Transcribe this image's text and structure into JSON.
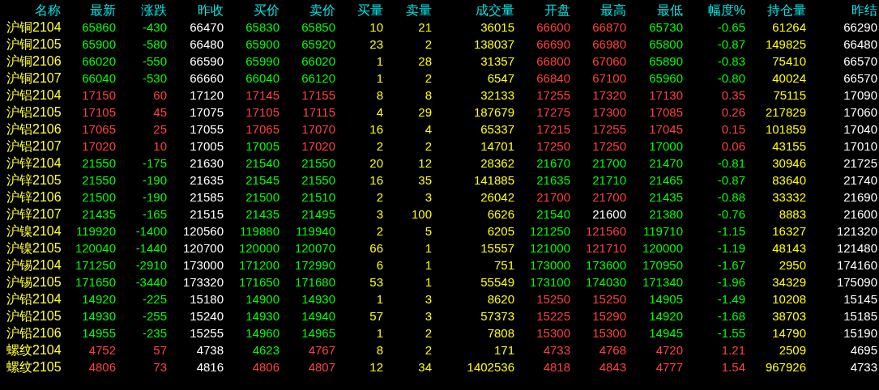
{
  "table": {
    "columns": [
      {
        "label": "名称",
        "kind": "name"
      },
      {
        "label": "最新",
        "kind": "price"
      },
      {
        "label": "涨跌",
        "kind": "change"
      },
      {
        "label": "昨收",
        "kind": "ref"
      },
      {
        "label": "买价",
        "kind": "price"
      },
      {
        "label": "卖价",
        "kind": "price"
      },
      {
        "label": "买量",
        "kind": "volume"
      },
      {
        "label": "卖量",
        "kind": "volume"
      },
      {
        "label": "成交量",
        "kind": "volume"
      },
      {
        "label": "开盘",
        "kind": "price"
      },
      {
        "label": "最高",
        "kind": "price"
      },
      {
        "label": "最低",
        "kind": "price"
      },
      {
        "label": "幅度%",
        "kind": "change"
      },
      {
        "label": "持仓量",
        "kind": "volume"
      },
      {
        "label": "昨结",
        "kind": "settle"
      }
    ],
    "rows": [
      [
        "沪铜2104",
        "65860",
        "-430",
        "66470",
        "65830",
        "65850",
        "10",
        "21",
        "36015",
        "66600",
        "66870",
        "65730",
        "-0.65",
        "61264",
        "66290"
      ],
      [
        "沪铜2105",
        "65900",
        "-580",
        "66480",
        "65900",
        "65920",
        "23",
        "2",
        "138037",
        "66690",
        "66980",
        "65800",
        "-0.87",
        "149825",
        "66480"
      ],
      [
        "沪铜2106",
        "66020",
        "-550",
        "66590",
        "65990",
        "66020",
        "1",
        "28",
        "31357",
        "66800",
        "67060",
        "65890",
        "-0.83",
        "75410",
        "66570"
      ],
      [
        "沪铜2107",
        "66040",
        "-530",
        "66660",
        "66040",
        "66120",
        "1",
        "2",
        "6547",
        "66840",
        "67100",
        "65960",
        "-0.80",
        "40024",
        "66570"
      ],
      [
        "沪铝2104",
        "17150",
        "60",
        "17120",
        "17145",
        "17155",
        "8",
        "8",
        "32133",
        "17255",
        "17320",
        "17130",
        "0.35",
        "75115",
        "17090"
      ],
      [
        "沪铝2105",
        "17105",
        "45",
        "17075",
        "17105",
        "17115",
        "4",
        "29",
        "187679",
        "17275",
        "17300",
        "17085",
        "0.26",
        "217829",
        "17060"
      ],
      [
        "沪铝2106",
        "17065",
        "25",
        "17055",
        "17065",
        "17070",
        "16",
        "4",
        "65337",
        "17215",
        "17255",
        "17045",
        "0.15",
        "101859",
        "17040"
      ],
      [
        "沪铝2107",
        "17020",
        "10",
        "17005",
        "17005",
        "17020",
        "2",
        "2",
        "14701",
        "17250",
        "17250",
        "17000",
        "0.06",
        "43155",
        "17010"
      ],
      [
        "沪锌2104",
        "21550",
        "-175",
        "21630",
        "21540",
        "21550",
        "20",
        "12",
        "28362",
        "21670",
        "21700",
        "21470",
        "-0.81",
        "30946",
        "21725"
      ],
      [
        "沪锌2105",
        "21550",
        "-190",
        "21635",
        "21545",
        "21550",
        "16",
        "35",
        "141885",
        "21635",
        "21710",
        "21465",
        "-0.87",
        "83640",
        "21740"
      ],
      [
        "沪锌2106",
        "21500",
        "-190",
        "21585",
        "21500",
        "21510",
        "2",
        "3",
        "26042",
        "21700",
        "21700",
        "21435",
        "-0.88",
        "33332",
        "21690"
      ],
      [
        "沪锌2107",
        "21435",
        "-165",
        "21515",
        "21435",
        "21495",
        "3",
        "100",
        "6626",
        "21540",
        "21600",
        "21380",
        "-0.76",
        "8883",
        "21600"
      ],
      [
        "沪镍2104",
        "119920",
        "-1400",
        "120560",
        "119880",
        "119940",
        "2",
        "5",
        "6205",
        "121250",
        "121560",
        "119710",
        "-1.15",
        "16327",
        "121320"
      ],
      [
        "沪镍2105",
        "120040",
        "-1440",
        "120700",
        "120000",
        "120070",
        "66",
        "1",
        "15557",
        "121000",
        "121710",
        "120000",
        "-1.19",
        "48143",
        "121480"
      ],
      [
        "沪锡2104",
        "171250",
        "-2910",
        "173000",
        "171200",
        "172990",
        "6",
        "1",
        "751",
        "173000",
        "173600",
        "170950",
        "-1.67",
        "2950",
        "174160"
      ],
      [
        "沪锡2105",
        "171650",
        "-3440",
        "173320",
        "171650",
        "171680",
        "53",
        "1",
        "55549",
        "173100",
        "174030",
        "171340",
        "-1.96",
        "34329",
        "175090"
      ],
      [
        "沪铅2104",
        "14920",
        "-225",
        "15180",
        "14900",
        "14930",
        "1",
        "3",
        "8620",
        "15250",
        "15250",
        "14905",
        "-1.49",
        "10208",
        "15145"
      ],
      [
        "沪铅2105",
        "14930",
        "-255",
        "15240",
        "14930",
        "14940",
        "57",
        "3",
        "57373",
        "15225",
        "15290",
        "14920",
        "-1.68",
        "38703",
        "15185"
      ],
      [
        "沪铅2106",
        "14955",
        "-235",
        "15255",
        "14960",
        "14965",
        "1",
        "2",
        "7808",
        "15300",
        "15300",
        "14945",
        "-1.55",
        "14790",
        "15190"
      ],
      [
        "螺纹2104",
        "4752",
        "57",
        "4738",
        "4623",
        "4767",
        "8",
        "2",
        "171",
        "4733",
        "4768",
        "4720",
        "1.21",
        "2509",
        "4695"
      ],
      [
        "螺纹2105",
        "4806",
        "73",
        "4816",
        "4806",
        "4807",
        "12",
        "34",
        "1402536",
        "4818",
        "4843",
        "4777",
        "1.54",
        "967926",
        "4733"
      ]
    ]
  }
}
